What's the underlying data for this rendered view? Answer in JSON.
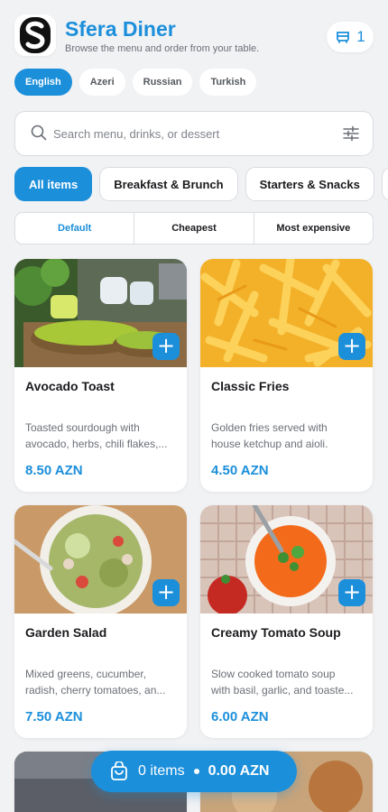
{
  "header": {
    "title": "Sfera Diner",
    "subtitle": "Browse the menu and order from your table.",
    "cart_count": "1",
    "icons": {
      "logo": "sfera-logo",
      "cart": "cart-icon"
    }
  },
  "languages": [
    {
      "label": "English",
      "active": true
    },
    {
      "label": "Azeri",
      "active": false
    },
    {
      "label": "Russian",
      "active": false
    },
    {
      "label": "Turkish",
      "active": false
    }
  ],
  "search": {
    "placeholder": "Search menu, drinks, or dessert",
    "value": "",
    "icons": {
      "search": "search-icon",
      "filter": "filter-sliders-icon"
    }
  },
  "categories": [
    {
      "label": "All items",
      "active": true
    },
    {
      "label": "Breakfast & Brunch",
      "active": false
    },
    {
      "label": "Starters & Snacks",
      "active": false
    }
  ],
  "sort": [
    {
      "label": "Default",
      "active": true
    },
    {
      "label": "Cheapest",
      "active": false
    },
    {
      "label": "Most expensive",
      "active": false
    }
  ],
  "menu": [
    {
      "name": "Avocado Toast",
      "desc1": "Toasted sourdough with",
      "desc2": "avocado, herbs, chili flakes,...",
      "price": "8.50 AZN"
    },
    {
      "name": "Classic Fries",
      "desc1": "Golden fries served with",
      "desc2": "house ketchup and aioli.",
      "price": "4.50 AZN"
    },
    {
      "name": "Garden Salad",
      "desc1": "Mixed greens, cucumber,",
      "desc2": "radish, cherry tomatoes, an...",
      "price": "7.50 AZN"
    },
    {
      "name": "Creamy Tomato Soup",
      "desc1": "Slow cooked tomato soup",
      "desc2": "with basil, garlic, and toaste...",
      "price": "6.00 AZN"
    }
  ],
  "cart_bar": {
    "items": "0 items",
    "total": "0.00 AZN"
  },
  "colors": {
    "accent": "#1c8fdb",
    "background": "#f1f2f4"
  }
}
